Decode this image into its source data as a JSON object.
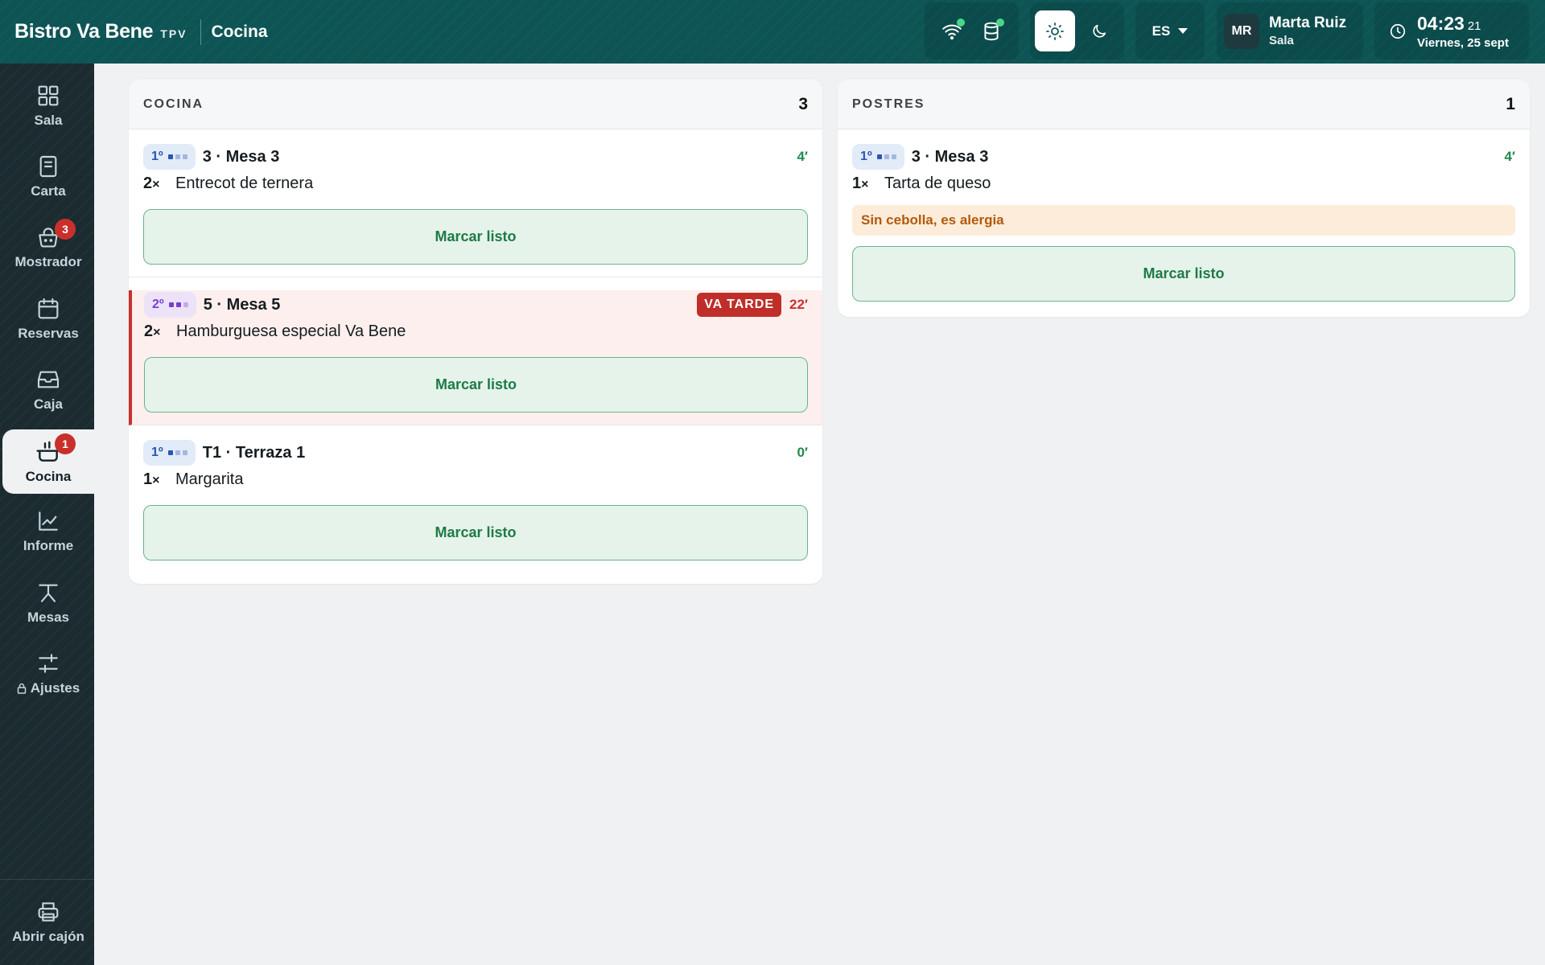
{
  "header": {
    "brand_name": "Bistro Va Bene",
    "brand_tag": "TPV",
    "section": "Cocina",
    "language": "ES",
    "user": {
      "initials": "MR",
      "name": "Marta Ruiz",
      "role": "Sala"
    },
    "clock": {
      "time": "04:23",
      "seconds": "21",
      "date": "Viernes, 25 sept"
    },
    "status_colors": {
      "online": "#4bd68a"
    }
  },
  "sidebar": {
    "items": [
      {
        "label": "Sala",
        "icon": "grid-icon"
      },
      {
        "label": "Carta",
        "icon": "document-icon"
      },
      {
        "label": "Mostrador",
        "icon": "basket-icon",
        "badge": "3"
      },
      {
        "label": "Reservas",
        "icon": "calendar-icon"
      },
      {
        "label": "Caja",
        "icon": "cash-drawer-icon"
      },
      {
        "label": "Cocina",
        "icon": "pot-icon",
        "badge": "1",
        "active": true
      },
      {
        "label": "Informe",
        "icon": "chart-icon"
      },
      {
        "label": "Mesas",
        "icon": "table-icon"
      },
      {
        "label": "Ajustes",
        "icon": "sliders-icon",
        "locked": true
      }
    ],
    "bottom": {
      "label": "Abrir cajón",
      "icon": "printer-icon"
    }
  },
  "stations": [
    {
      "title": "COCINA",
      "count": "3",
      "orders": [
        {
          "course": "1º",
          "table": "3 · Mesa 3",
          "elapsed": "4′",
          "qty": "2",
          "item": "Entrecot de ternera",
          "button": "Marcar listo"
        },
        {
          "course": "2º",
          "table": "5 · Mesa 5",
          "late_label": "VA TARDE",
          "elapsed": "22′",
          "qty": "2",
          "item": "Hamburguesa especial Va Bene",
          "button": "Marcar listo"
        },
        {
          "course": "1º",
          "table": "T1 · Terraza 1",
          "elapsed": "0′",
          "qty": "1",
          "item": "Margarita",
          "button": "Marcar listo"
        }
      ]
    },
    {
      "title": "POSTRES",
      "count": "1",
      "orders": [
        {
          "course": "1º",
          "table": "3 · Mesa 3",
          "elapsed": "4′",
          "qty": "1",
          "item": "Tarta de queso",
          "note": "Sin cebolla, es alergia",
          "button": "Marcar listo"
        }
      ]
    }
  ],
  "qty_suffix": "×"
}
